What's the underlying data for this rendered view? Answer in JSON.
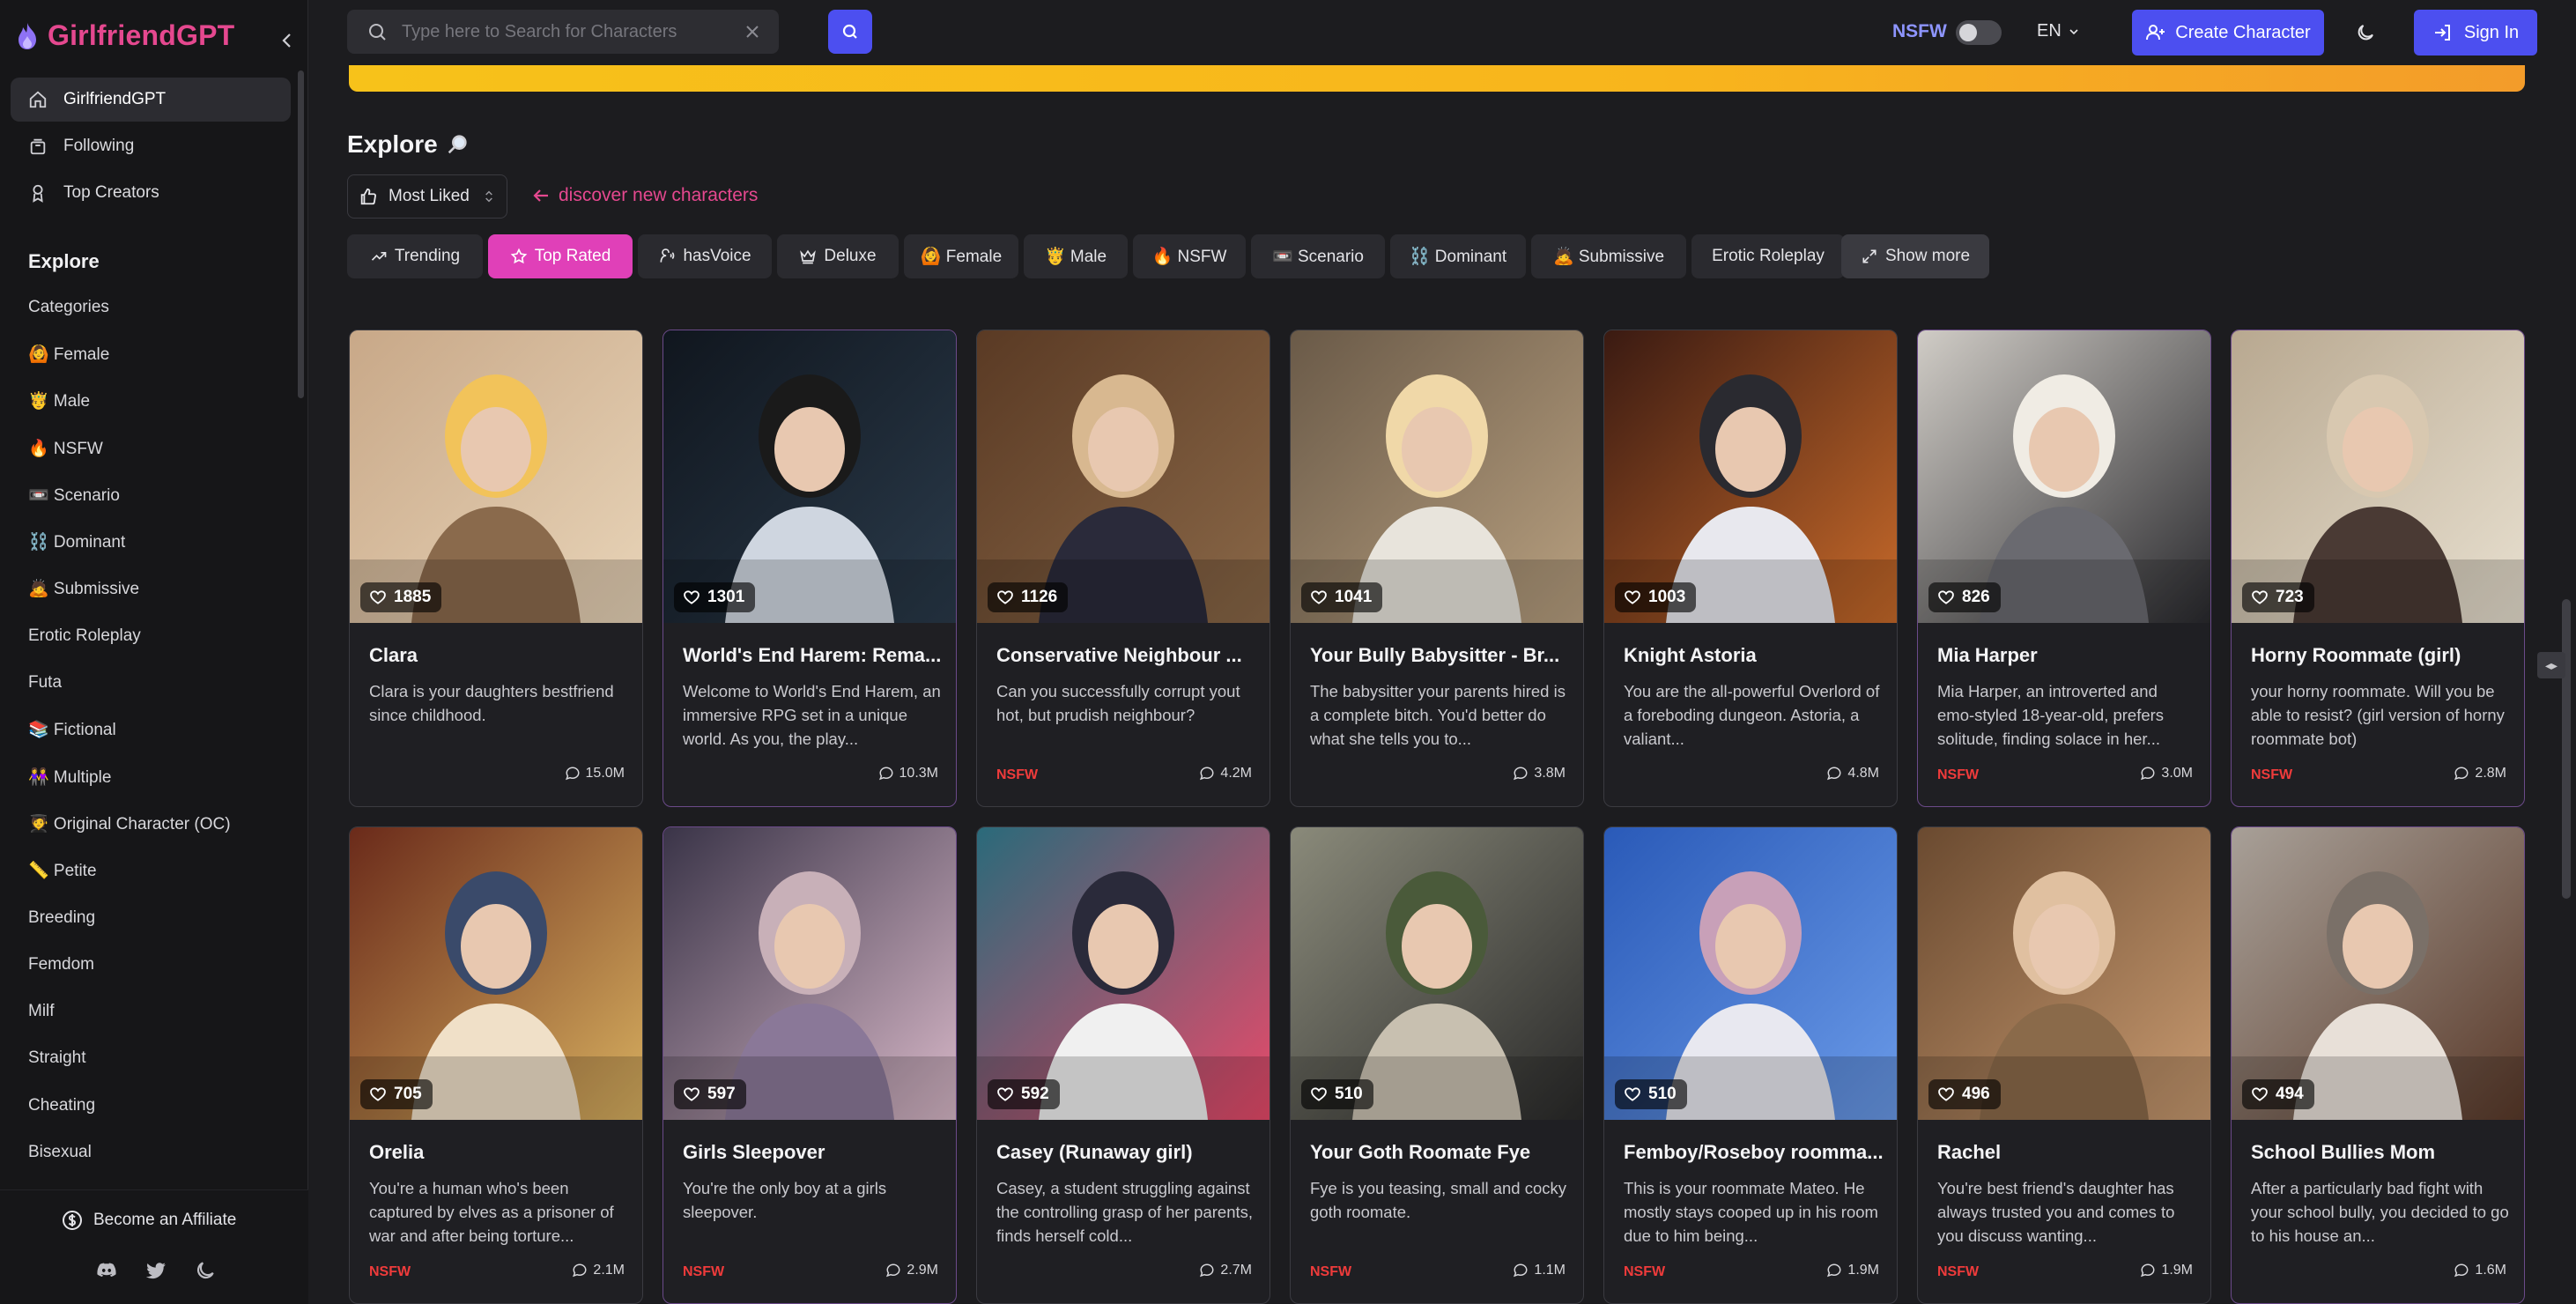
{
  "brand": {
    "name": "GirlfriendGPT"
  },
  "sidebar": {
    "top_items": [
      {
        "label": "GirlfriendGPT",
        "icon": "home-icon"
      },
      {
        "label": "Following",
        "icon": "following-icon"
      },
      {
        "label": "Top Creators",
        "icon": "user-icon"
      }
    ],
    "explore_title": "Explore",
    "categories": [
      "Categories",
      "🙆 Female",
      "🤴 Male",
      "🔥 NSFW",
      "📼 Scenario",
      "⛓️ Dominant",
      "🙇 Submissive",
      "Erotic Roleplay",
      "Futa",
      "📚 Fictional",
      "👭 Multiple",
      "🧑‍🎓 Original Character (OC)",
      "📏 Petite",
      "Breeding",
      "Femdom",
      "Milf",
      "Straight",
      "Cheating",
      "Bisexual"
    ],
    "affiliate_label": "Become an Affiliate",
    "social_icons": [
      "discord-icon",
      "twitter-icon",
      "moon-icon"
    ]
  },
  "header": {
    "search_placeholder": "Type here to Search for Characters",
    "nsfw_label": "NSFW",
    "nsfw_enabled": false,
    "language": "EN",
    "create_label": "Create Character",
    "signin_label": "Sign In",
    "accent": "#4c4ff0"
  },
  "main": {
    "explore_heading": "Explore",
    "sort_value": "Most Liked",
    "discover_text": "discover new characters",
    "tags": [
      {
        "label": "Trending",
        "icon": "trending-icon",
        "active": false
      },
      {
        "label": "Top Rated",
        "icon": "star-icon",
        "active": true
      },
      {
        "label": "hasVoice",
        "icon": "voice-icon",
        "active": false
      },
      {
        "label": "Deluxe",
        "icon": "crown-icon",
        "active": false
      },
      {
        "label": "🙆 Female",
        "active": false
      },
      {
        "label": "🤴 Male",
        "active": false
      },
      {
        "label": "🔥 NSFW",
        "active": false
      },
      {
        "label": "📼 Scenario",
        "active": false
      },
      {
        "label": "⛓️ Dominant",
        "active": false
      },
      {
        "label": "🙇 Submissive",
        "active": false
      },
      {
        "label": "Erotic Roleplay",
        "active": false
      },
      {
        "label": "Show more",
        "icon": "expand-icon",
        "active": false
      }
    ],
    "cards": [
      {
        "likes": "1885",
        "name": "Clara",
        "desc": "Clara is your daughters bestfriend since childhood.",
        "nsfw": "",
        "chats": "15.0M"
      },
      {
        "likes": "1301",
        "name": "World's End Harem: Rema...",
        "desc": "Welcome to World's End Harem, an immersive RPG set in a unique world. As you, the play...",
        "nsfw": "",
        "chats": "10.3M"
      },
      {
        "likes": "1126",
        "name": "Conservative Neighbour ...",
        "desc": "Can you successfully corrupt yout hot, but prudish neighbour?",
        "nsfw": "NSFW",
        "chats": "4.2M"
      },
      {
        "likes": "1041",
        "name": "Your Bully Babysitter - Br...",
        "desc": "The babysitter your parents hired is a complete bitch. You'd better do what she tells you to...",
        "nsfw": "",
        "chats": "3.8M"
      },
      {
        "likes": "1003",
        "name": "Knight Astoria",
        "desc": "You are the all-powerful Overlord of a foreboding dungeon. Astoria, a valiant...",
        "nsfw": "",
        "chats": "4.8M"
      },
      {
        "likes": "826",
        "name": "Mia Harper",
        "desc": "Mia Harper, an introverted and emo-styled 18-year-old, prefers solitude, finding solace in her...",
        "nsfw": "NSFW",
        "chats": "3.0M"
      },
      {
        "likes": "723",
        "name": "Horny Roommate (girl)",
        "desc": "your horny roommate. Will you be able to resist? (girl version of horny roommate bot)",
        "nsfw": "NSFW",
        "chats": "2.8M"
      },
      {
        "likes": "705",
        "name": "Orelia",
        "desc": "You're a human who's been captured by elves as a prisoner of war and after being torture...",
        "nsfw": "NSFW",
        "chats": "2.1M"
      },
      {
        "likes": "597",
        "name": "Girls Sleepover",
        "desc": "You're the only boy at a girls sleepover.",
        "nsfw": "NSFW",
        "chats": "2.9M"
      },
      {
        "likes": "592",
        "name": "Casey (Runaway girl)",
        "desc": "Casey, a student struggling against the controlling grasp of her parents, finds herself cold...",
        "nsfw": "",
        "chats": "2.7M"
      },
      {
        "likes": "510",
        "name": "Your Goth Roomate Fye",
        "desc": "Fye is you teasing, small and cocky goth roomate.",
        "nsfw": "NSFW",
        "chats": "1.1M"
      },
      {
        "likes": "510",
        "name": "Femboy/Roseboy roomma...",
        "desc": "This is your roommate Mateo. He mostly stays cooped up in his room due to him being...",
        "nsfw": "NSFW",
        "chats": "1.9M"
      },
      {
        "likes": "496",
        "name": "Rachel",
        "desc": "You're best friend's daughter has always trusted you and comes to you discuss wanting...",
        "nsfw": "NSFW",
        "chats": "1.9M"
      },
      {
        "likes": "494",
        "name": "School Bullies Mom",
        "desc": "After a particularly bad fight with your school bully, you decided to go to his house an...",
        "nsfw": "",
        "chats": "1.6M"
      }
    ]
  }
}
